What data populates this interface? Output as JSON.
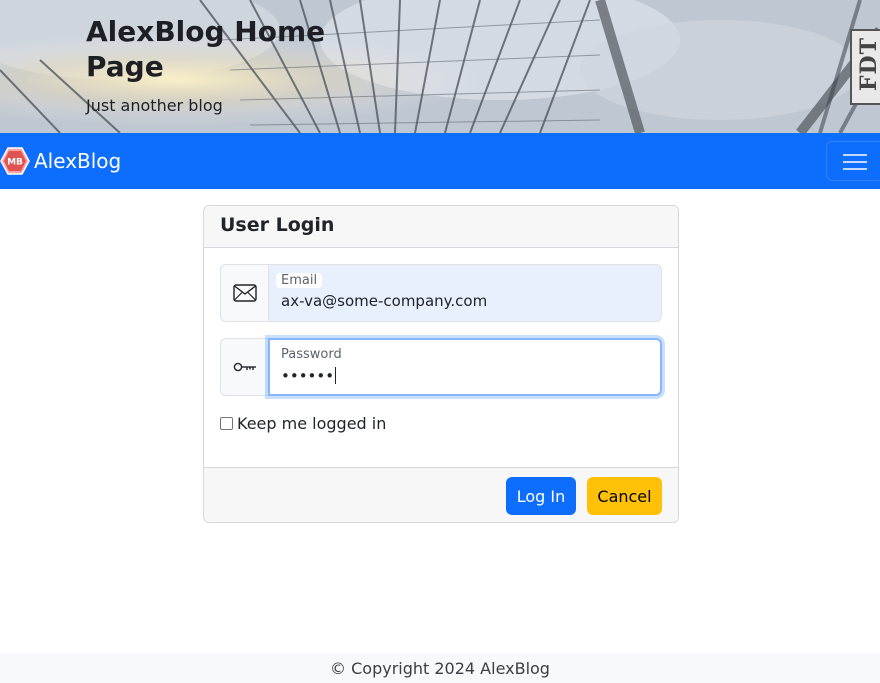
{
  "header": {
    "title": "AlexBlog Home Page",
    "tagline": "Just another blog",
    "badge": "FDT"
  },
  "navbar": {
    "logo_text": "MB",
    "brand": "AlexBlog",
    "menu_icon": "hamburger-icon",
    "color": "#0d6efd"
  },
  "login": {
    "heading": "User Login",
    "email": {
      "label": "Email",
      "value": "ax-va@some-company.com",
      "icon": "envelope-icon"
    },
    "password": {
      "label": "Password",
      "value": "••••••",
      "icon": "key-icon"
    },
    "remember_label": "Keep me logged in",
    "login_button": "Log In",
    "cancel_button": "Cancel"
  },
  "footer": {
    "copyright": "© Copyright 2024 AlexBlog"
  },
  "colors": {
    "primary": "#0d6efd",
    "warning": "#ffc107",
    "focus_ring": "#86b7fe",
    "autofill": "#e8f0fe"
  }
}
